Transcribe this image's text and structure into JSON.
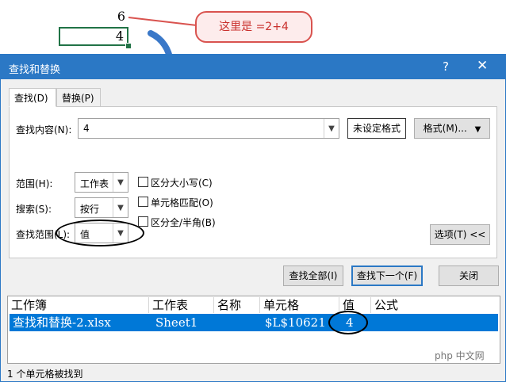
{
  "sheet": {
    "cell_above_value": "6",
    "selected_cell_value": "4"
  },
  "callout": {
    "text": "这里是 =2+4"
  },
  "dialog": {
    "title": "查找和替换",
    "help_label": "?",
    "close_label": "✕",
    "tabs": [
      {
        "label": "查找(D)"
      },
      {
        "label": "替换(P)"
      }
    ],
    "find": {
      "label": "查找内容(N):",
      "value": "4",
      "format_preview": "未设定格式",
      "format_button": "格式(M)..."
    },
    "options": {
      "within": {
        "label": "范围(H):",
        "value": "工作表"
      },
      "search": {
        "label": "搜索(S):",
        "value": "按行"
      },
      "look_in": {
        "label": "查找范围(L):",
        "value": "值"
      },
      "match_case": "区分大小写(C)",
      "match_entire": "单元格匹配(O)",
      "match_byte": "区分全/半角(B)",
      "options_button": "选项(T) <<"
    },
    "buttons": {
      "find_all": "查找全部(I)",
      "find_next": "查找下一个(F)",
      "close": "关闭"
    },
    "results": {
      "columns": [
        "工作簿",
        "工作表",
        "名称",
        "单元格",
        "值",
        "公式"
      ],
      "rows": [
        {
          "workbook": "查找和替换-2.xlsx",
          "sheet": "Sheet1",
          "name": "",
          "cell": "$L$10621",
          "value": "4",
          "formula": ""
        }
      ]
    },
    "status": "1 个单元格被找到"
  },
  "watermark": {
    "text": "php 中文网"
  },
  "colors": {
    "accent": "#2b78c5",
    "selection": "#0078d7",
    "callout_border": "#d9534f"
  }
}
